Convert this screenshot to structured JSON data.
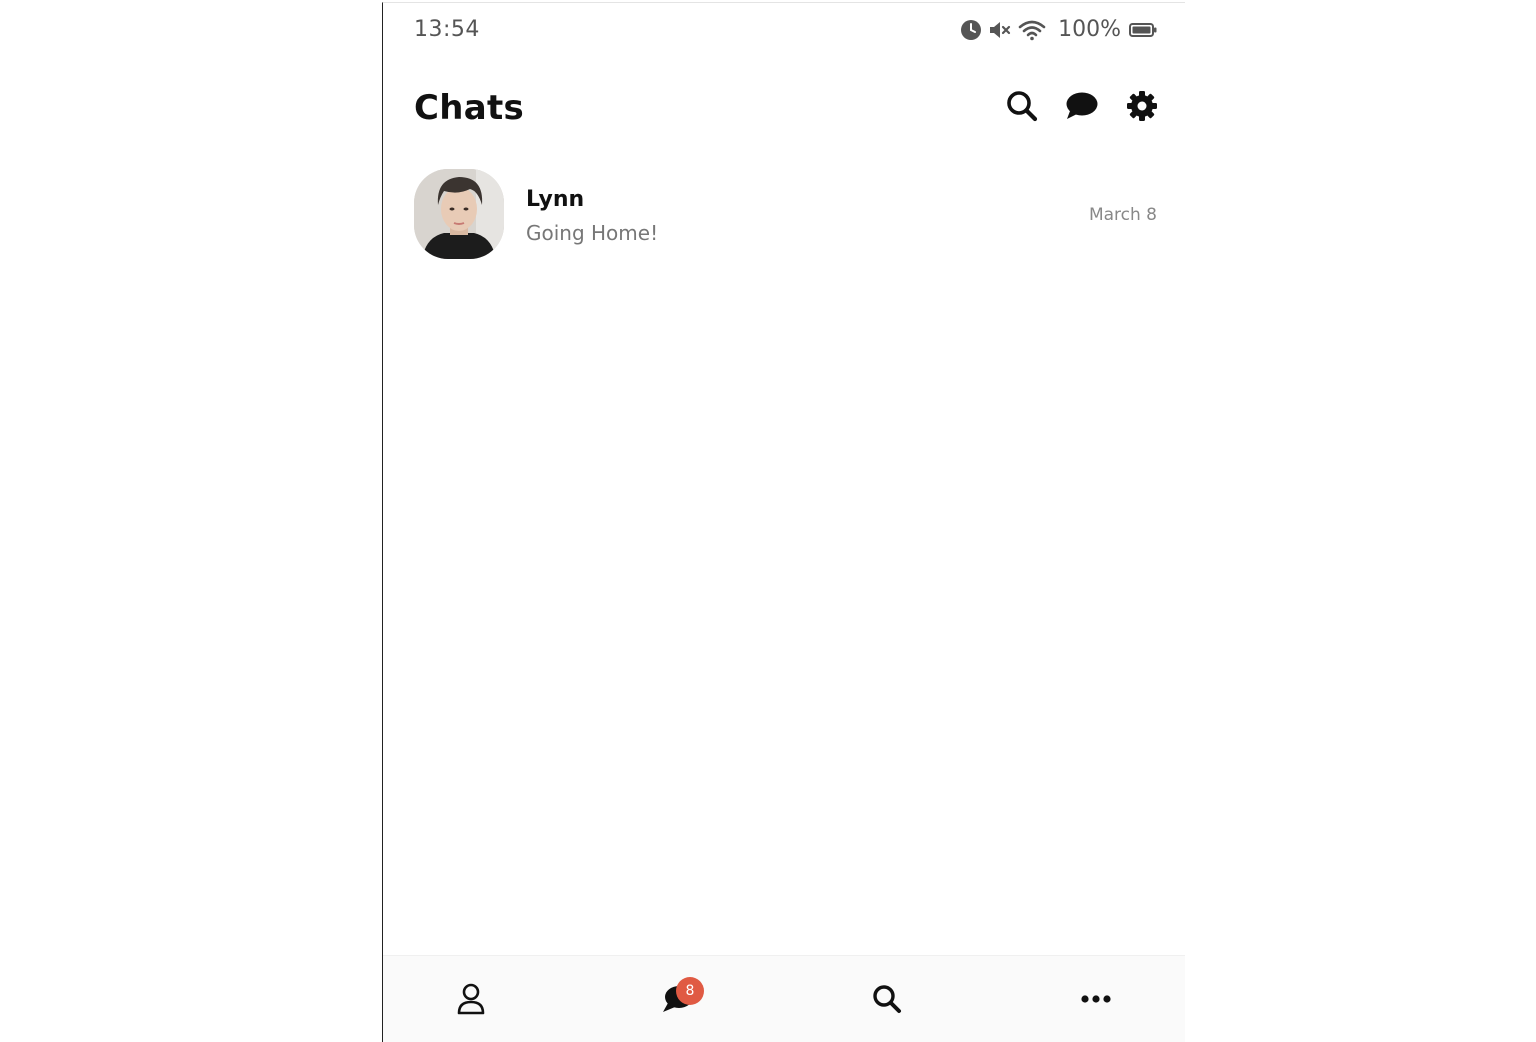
{
  "statusbar": {
    "time": "13:54",
    "battery_percent": "100%",
    "icons": [
      "alarm-icon",
      "mute-icon",
      "wifi-icon",
      "battery-icon"
    ]
  },
  "header": {
    "title": "Chats",
    "actions": [
      "search-icon",
      "new-chat-icon",
      "settings-icon"
    ]
  },
  "chats": [
    {
      "name": "Lynn",
      "preview": "Going Home!",
      "time": "March 8"
    }
  ],
  "tabbar": {
    "tabs": [
      "profile-icon",
      "chats-icon",
      "search-icon",
      "more-icon"
    ],
    "chats_badge": "8"
  },
  "colors": {
    "badge": "#e05a43",
    "text_primary": "#111111",
    "text_secondary": "#777777"
  }
}
